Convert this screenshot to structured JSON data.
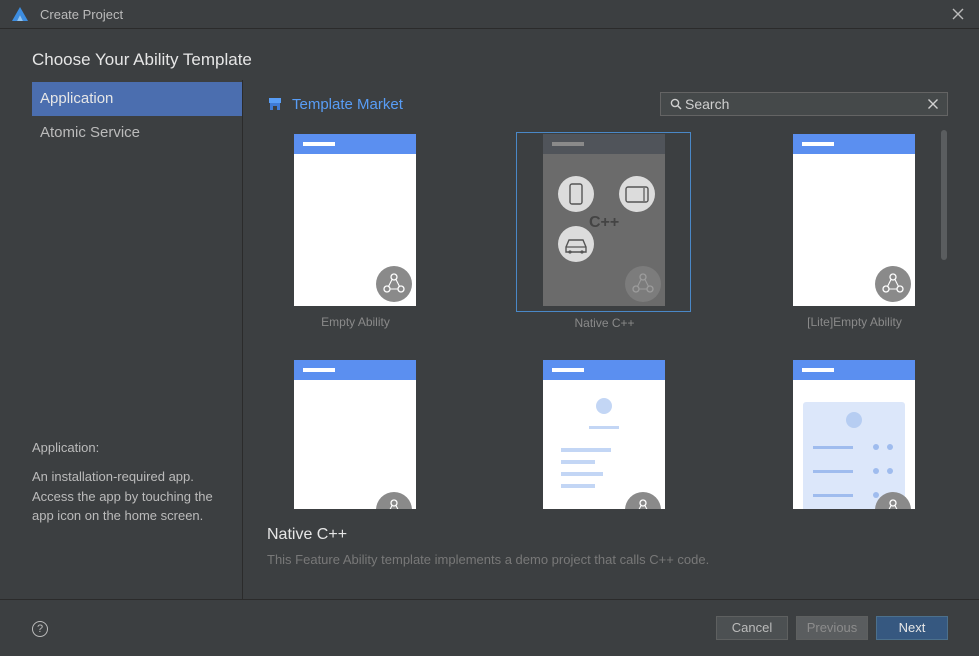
{
  "window": {
    "title": "Create Project"
  },
  "heading": "Choose Your Ability Template",
  "sidebar": {
    "items": [
      {
        "label": "Application",
        "selected": true
      },
      {
        "label": "Atomic Service",
        "selected": false
      }
    ],
    "desc_title": "Application:",
    "desc_text": "An installation-required app. Access the app by touching the app icon on the home screen."
  },
  "market": {
    "label": "Template Market"
  },
  "search": {
    "placeholder": "Search",
    "value": ""
  },
  "templates": [
    {
      "label": "Empty Ability",
      "icon": "ability-badge-icon"
    },
    {
      "label": "Native C++",
      "icon": "cpp-icon",
      "selected": true
    },
    {
      "label": "[Lite]Empty Ability",
      "icon": "ability-badge-icon"
    },
    {
      "label": "",
      "icon": "ability-badge-icon"
    },
    {
      "label": "",
      "icon": "ability-badge-icon"
    },
    {
      "label": "",
      "icon": "ability-badge-icon"
    }
  ],
  "cpp_text": "C++",
  "detail": {
    "title": "Native C++",
    "description": "This Feature Ability template implements a demo project that calls C++ code."
  },
  "footer": {
    "help": "?",
    "cancel": "Cancel",
    "previous": "Previous",
    "next": "Next"
  },
  "colors": {
    "accent": "#4b6eaf",
    "link": "#589df6",
    "header_bar": "#5b8ff0",
    "next_button": "#365880"
  }
}
